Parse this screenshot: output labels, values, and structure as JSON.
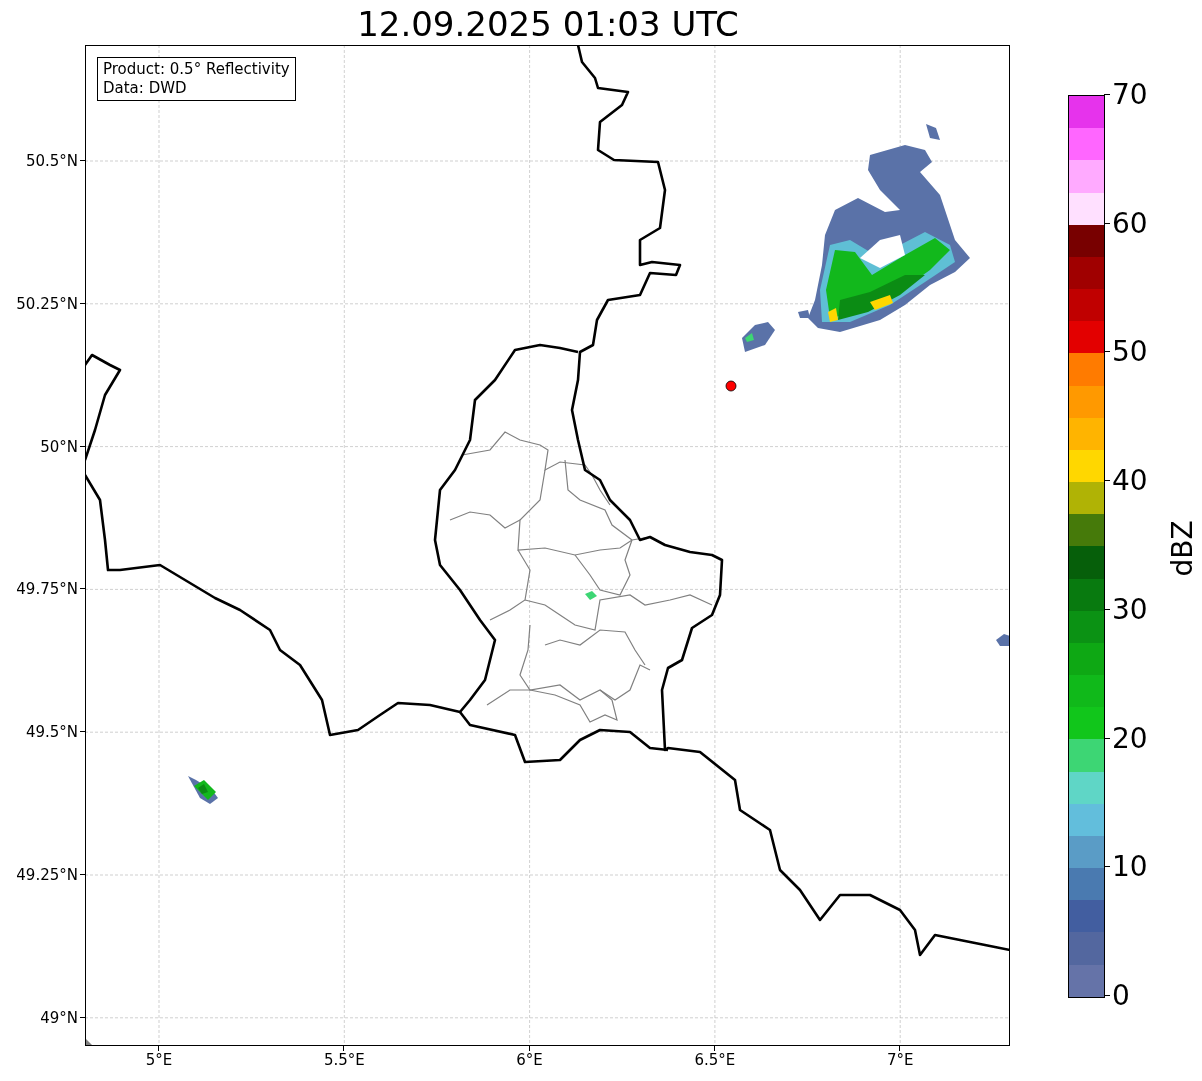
{
  "title": "12.09.2025 01:03 UTC",
  "info_box": {
    "lines": [
      "Product: 0.5° Reflectivity",
      "Data: DWD"
    ]
  },
  "map": {
    "x_ticks": [
      "5°E",
      "5.5°E",
      "6°E",
      "6.5°E",
      "7°E"
    ],
    "y_ticks": [
      "50.5°N",
      "50.25°N",
      "50°N",
      "49.75°N",
      "49.5°N",
      "49.25°N",
      "49°N"
    ]
  },
  "colorbar": {
    "label": "dBZ",
    "ticks": [
      "70",
      "60",
      "50",
      "40",
      "30",
      "20",
      "10",
      "0"
    ],
    "bins": [
      {
        "color": "#e633ec"
      },
      {
        "color": "#ff66ff"
      },
      {
        "color": "#ffaaff"
      },
      {
        "color": "#ffe0ff"
      },
      {
        "color": "#780000"
      },
      {
        "color": "#a00000"
      },
      {
        "color": "#c00000"
      },
      {
        "color": "#e30000"
      },
      {
        "color": "#ff7b00"
      },
      {
        "color": "#ff9900"
      },
      {
        "color": "#ffb400"
      },
      {
        "color": "#ffd700"
      },
      {
        "color": "#b0b305"
      },
      {
        "color": "#467a0a"
      },
      {
        "color": "#065f0a"
      },
      {
        "color": "#087a0f"
      },
      {
        "color": "#0b9214"
      },
      {
        "color": "#0ea814"
      },
      {
        "color": "#10b91a"
      },
      {
        "color": "#11c61b"
      },
      {
        "color": "#3dd674"
      },
      {
        "color": "#5fd6c6"
      },
      {
        "color": "#62bedc"
      },
      {
        "color": "#5a9cc6"
      },
      {
        "color": "#4a7ab0"
      },
      {
        "color": "#425ea0"
      },
      {
        "color": "#53679f"
      },
      {
        "color": "#6573a8"
      }
    ]
  }
}
